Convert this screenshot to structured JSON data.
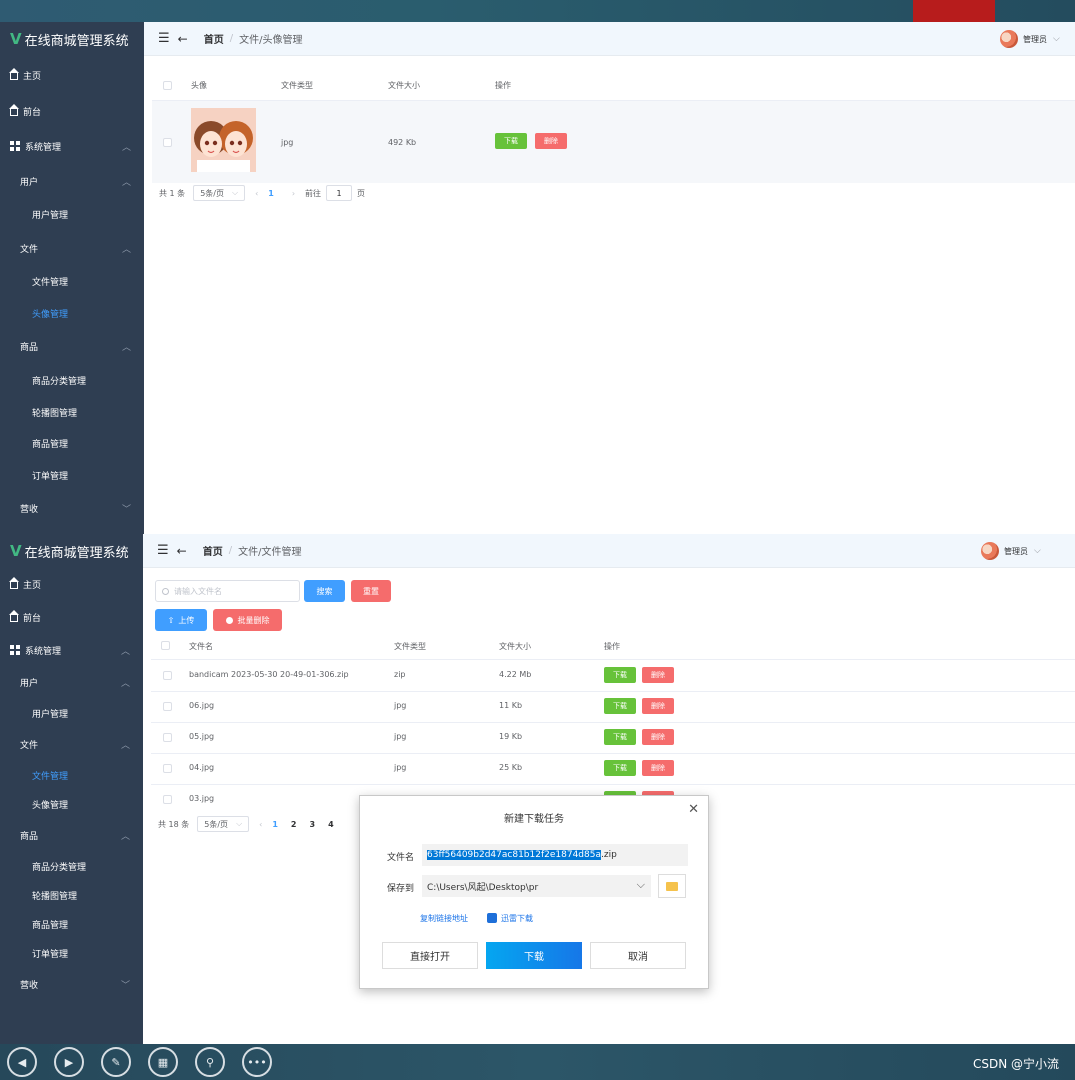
{
  "brand": {
    "title": "在线商城管理系统",
    "logo": "V"
  },
  "header": {
    "home": "首页",
    "sep": "/",
    "user": "管理员"
  },
  "menu": {
    "home": "主页",
    "front": "前台",
    "system": "系统管理",
    "user": "用户",
    "user_mgmt": "用户管理",
    "file": "文件",
    "file_mgmt": "文件管理",
    "avatar_mgmt": "头像管理",
    "goods": "商品",
    "goods_category": "商品分类管理",
    "carousel": "轮播图管理",
    "goods_mgmt": "商品管理",
    "order_mgmt": "订单管理",
    "revenue": "营收"
  },
  "panel1": {
    "breadcrumb_current": "文件/头像管理",
    "columns": [
      "头像",
      "文件类型",
      "文件大小",
      "操作"
    ],
    "rows": [
      {
        "type": "jpg",
        "size": "492 Kb"
      }
    ],
    "actions": {
      "download": "下载",
      "delete": "删除"
    },
    "pager": {
      "total": "共 1 条",
      "page_size": "5条/页",
      "page": "1",
      "goto": "前往",
      "goto_value": "1",
      "page_suffix": "页"
    }
  },
  "panel2": {
    "breadcrumb_current": "文件/文件管理",
    "search_placeholder": "请输入文件名",
    "search_btn": "搜索",
    "reset_btn": "重置",
    "upload_btn": "上传",
    "batch_delete_btn": "批量删除",
    "columns": [
      "文件名",
      "文件类型",
      "文件大小",
      "操作"
    ],
    "rows": [
      {
        "name": "bandicam 2023-05-30 20-49-01-306.zip",
        "type": "zip",
        "size": "4.22 Mb"
      },
      {
        "name": "06.jpg",
        "type": "jpg",
        "size": "11 Kb"
      },
      {
        "name": "05.jpg",
        "type": "jpg",
        "size": "19 Kb"
      },
      {
        "name": "04.jpg",
        "type": "jpg",
        "size": "25 Kb"
      },
      {
        "name": "03.jpg",
        "type": "",
        "size": ""
      }
    ],
    "actions": {
      "download": "下载",
      "delete": "删除"
    },
    "pager": {
      "total": "共 18 条",
      "page_size": "5条/页",
      "pages": [
        "1",
        "2",
        "3",
        "4"
      ]
    }
  },
  "dialog": {
    "title": "新建下载任务",
    "filename_label": "文件名",
    "filename_selected": "63ff56409b2d47ac81b12f2e1874d85a",
    "filename_ext": ".zip",
    "saveto_label": "保存到",
    "saveto_path": "C:\\Users\\风起\\Desktop\\pr",
    "copy_link": "复制链接地址",
    "thunder": "迅雷下载",
    "open_btn": "直接打开",
    "download_btn": "下载",
    "cancel_btn": "取消"
  },
  "watermark": "CSDN @宁小流",
  "colors": {
    "sidebar": "#2f3e52",
    "primary": "#409eff",
    "success": "#67c23a",
    "danger": "#f56c6c",
    "brand_green": "#42b883"
  }
}
